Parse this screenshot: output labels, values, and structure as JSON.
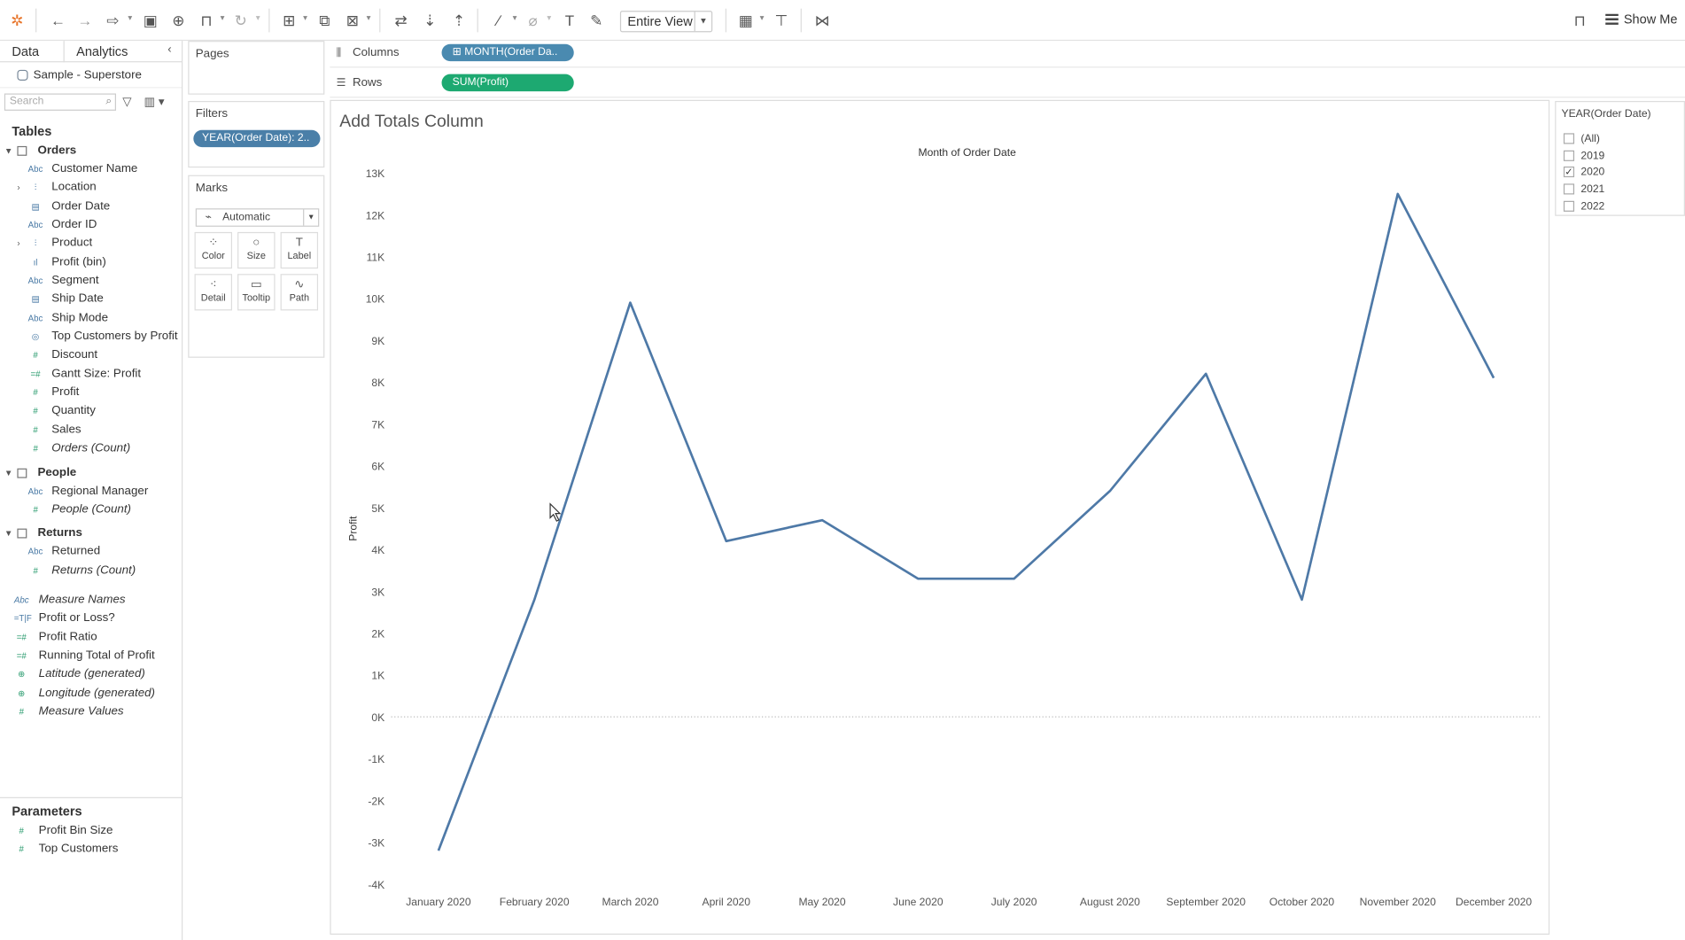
{
  "toolbar": {
    "view_select": "Entire View",
    "show_me": "Show Me"
  },
  "left_pane": {
    "tab_data": "Data",
    "tab_analytics": "Analytics",
    "datasource": "Sample - Superstore",
    "search_placeholder": "Search",
    "tables_heading": "Tables",
    "tables": [
      {
        "name": "Orders",
        "fields": [
          {
            "label": "Customer Name",
            "icon": "Abc",
            "kind": "dim"
          },
          {
            "label": "Location",
            "icon": "geo-hierarchy-icon",
            "kind": "dim",
            "expandable": true
          },
          {
            "label": "Order Date",
            "icon": "calendar-icon",
            "kind": "dim"
          },
          {
            "label": "Order ID",
            "icon": "Abc",
            "kind": "dim"
          },
          {
            "label": "Product",
            "icon": "hierarchy-icon",
            "kind": "dim",
            "expandable": true
          },
          {
            "label": "Profit (bin)",
            "icon": "bin-icon",
            "kind": "dim"
          },
          {
            "label": "Segment",
            "icon": "Abc",
            "kind": "dim"
          },
          {
            "label": "Ship Date",
            "icon": "calendar-icon",
            "kind": "dim"
          },
          {
            "label": "Ship Mode",
            "icon": "Abc",
            "kind": "dim"
          },
          {
            "label": "Top Customers by Profit",
            "icon": "set-icon",
            "kind": "dim"
          },
          {
            "label": "Discount",
            "icon": "#",
            "kind": "meas"
          },
          {
            "label": "Gantt Size: Profit",
            "icon": "=#",
            "kind": "meas"
          },
          {
            "label": "Profit",
            "icon": "#",
            "kind": "meas"
          },
          {
            "label": "Quantity",
            "icon": "#",
            "kind": "meas"
          },
          {
            "label": "Sales",
            "icon": "#",
            "kind": "meas"
          },
          {
            "label": "Orders (Count)",
            "icon": "#",
            "kind": "meas",
            "italic": true
          }
        ]
      },
      {
        "name": "People",
        "fields": [
          {
            "label": "Regional Manager",
            "icon": "Abc",
            "kind": "dim"
          },
          {
            "label": "People (Count)",
            "icon": "#",
            "kind": "meas",
            "italic": true
          }
        ]
      },
      {
        "name": "Returns",
        "fields": [
          {
            "label": "Returned",
            "icon": "Abc",
            "kind": "dim"
          },
          {
            "label": "Returns (Count)",
            "icon": "#",
            "kind": "meas",
            "italic": true
          }
        ]
      }
    ],
    "extra_fields": [
      {
        "label": "Measure Names",
        "icon": "Abc",
        "kind": "dim",
        "italic": true
      },
      {
        "label": "Profit or Loss?",
        "icon": "=T|F",
        "kind": "dim"
      },
      {
        "label": "Profit Ratio",
        "icon": "=#",
        "kind": "meas"
      },
      {
        "label": "Running Total of Profit",
        "icon": "=#",
        "kind": "meas"
      },
      {
        "label": "Latitude (generated)",
        "icon": "globe-icon",
        "kind": "meas",
        "italic": true
      },
      {
        "label": "Longitude (generated)",
        "icon": "globe-icon",
        "kind": "meas",
        "italic": true
      },
      {
        "label": "Measure Values",
        "icon": "#",
        "kind": "meas",
        "italic": true
      }
    ],
    "parameters_heading": "Parameters",
    "parameters": [
      {
        "label": "Profit Bin Size",
        "icon": "#"
      },
      {
        "label": "Top Customers",
        "icon": "#"
      }
    ]
  },
  "cards": {
    "pages": "Pages",
    "filters": "Filters",
    "filter_pill": "YEAR(Order Date): 2..",
    "marks": "Marks",
    "mark_type": "Automatic",
    "mark_buttons": [
      {
        "label": "Color",
        "glyph": "⁘"
      },
      {
        "label": "Size",
        "glyph": "○"
      },
      {
        "label": "Label",
        "glyph": "T"
      },
      {
        "label": "Detail",
        "glyph": "⁖"
      },
      {
        "label": "Tooltip",
        "glyph": "▭"
      },
      {
        "label": "Path",
        "glyph": "∿"
      }
    ]
  },
  "shelves": {
    "columns_label": "Columns",
    "columns_pill": "MONTH(Order Da..",
    "rows_label": "Rows",
    "rows_pill": "SUM(Profit)"
  },
  "view": {
    "title": "Add Totals Column"
  },
  "year_filter": {
    "title": "YEAR(Order Date)",
    "items": [
      {
        "label": "(All)",
        "checked": false
      },
      {
        "label": "2019",
        "checked": false
      },
      {
        "label": "2020",
        "checked": true
      },
      {
        "label": "2021",
        "checked": false
      },
      {
        "label": "2022",
        "checked": false
      }
    ]
  },
  "chart_data": {
    "type": "line",
    "title": "Month of Order Date",
    "ylabel": "Profit",
    "categories": [
      "January 2020",
      "February 2020",
      "March 2020",
      "April 2020",
      "May 2020",
      "June 2020",
      "July 2020",
      "August 2020",
      "September 2020",
      "October 2020",
      "November 2020",
      "December 2020"
    ],
    "series": [
      {
        "values": [
          -3200,
          2800,
          9900,
          4200,
          4700,
          3300,
          3300,
          5400,
          8200,
          2800,
          12500,
          8100
        ]
      }
    ],
    "ylim": [
      -4000,
      13000
    ],
    "yticks": [
      "-4K",
      "-3K",
      "-2K",
      "-1K",
      "0K",
      "1K",
      "2K",
      "3K",
      "4K",
      "5K",
      "6K",
      "7K",
      "8K",
      "9K",
      "10K",
      "11K",
      "12K",
      "13K"
    ],
    "line_color": "#4e79a7",
    "zero_line": true
  }
}
